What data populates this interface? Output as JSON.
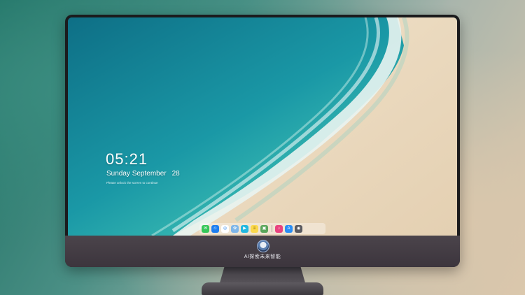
{
  "lockscreen": {
    "time": "05:21",
    "weekday_month": "Sunday September",
    "day": "28",
    "subtitle": "Please unlock the screen to continue"
  },
  "monitor": {
    "brand_label": "AI探索未来智能"
  },
  "dock": {
    "items": [
      {
        "name": "messages-icon",
        "color": "#35c759",
        "glyph": "✉"
      },
      {
        "name": "finder-icon",
        "color": "#1e7ef0",
        "glyph": "☺"
      },
      {
        "name": "safari-icon",
        "color": "#ffffff",
        "glyph": "◎"
      },
      {
        "name": "photos-icon",
        "color": "#7fb6e8",
        "glyph": "✿"
      },
      {
        "name": "clapper-icon",
        "color": "#22b8e0",
        "glyph": "▶"
      },
      {
        "name": "notes-icon",
        "color": "#fbd84c",
        "glyph": "≡"
      },
      {
        "name": "preview-icon",
        "color": "#5aa65a",
        "glyph": "▣"
      },
      {
        "name": "music-icon",
        "color": "#e9437f",
        "glyph": "♪"
      },
      {
        "name": "app-store-icon",
        "color": "#2a8ef5",
        "glyph": "A"
      },
      {
        "name": "camera-icon",
        "color": "#5a5a60",
        "glyph": "◉"
      }
    ]
  }
}
